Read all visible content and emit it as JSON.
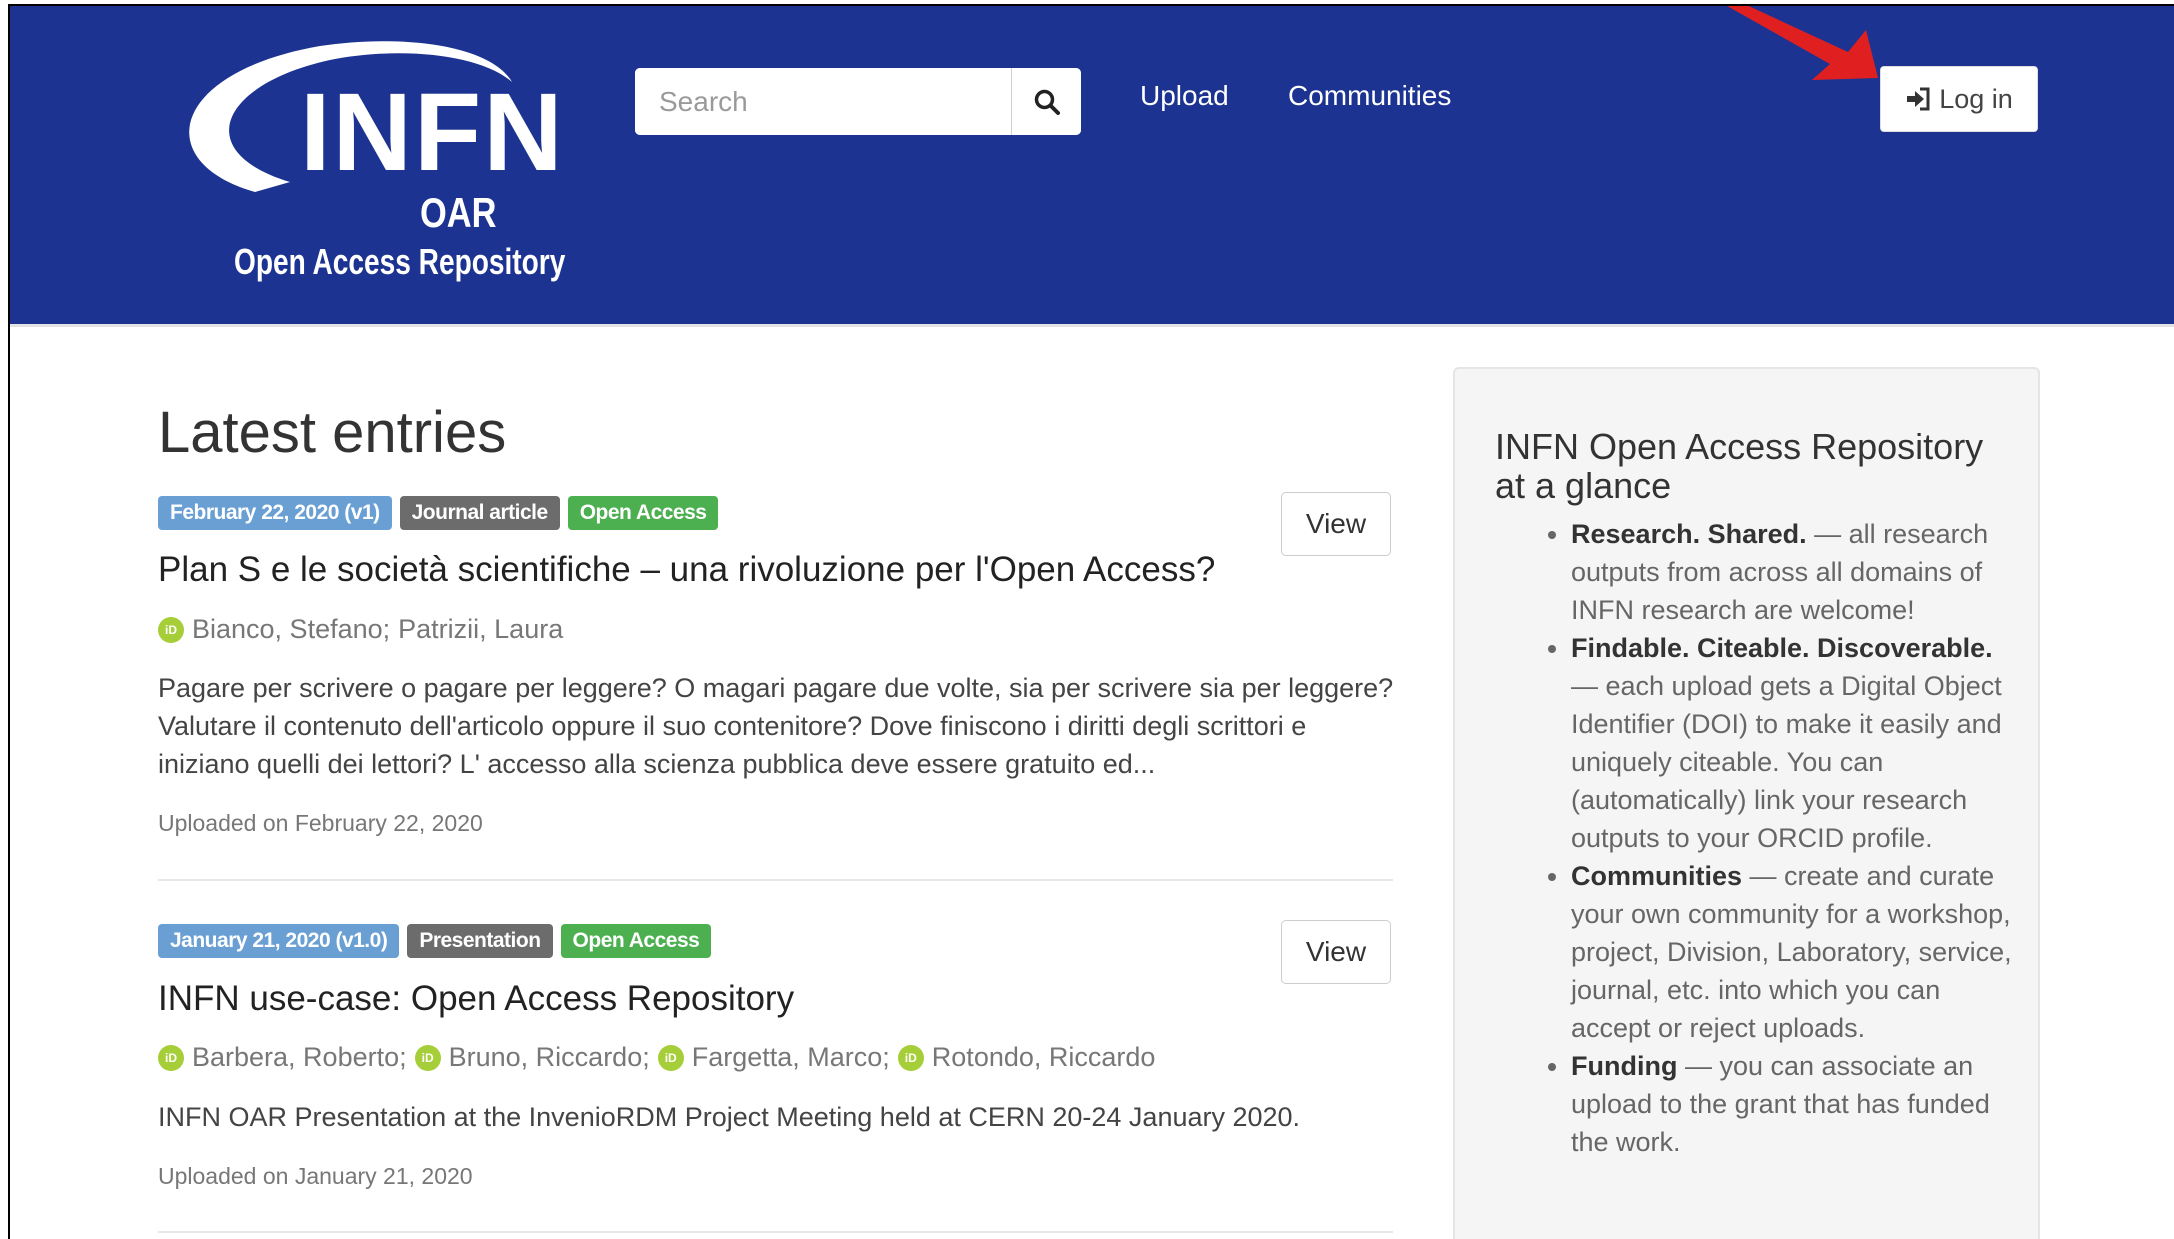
{
  "header": {
    "logo": {
      "main": "INFN",
      "sub1": "OAR",
      "sub2": "Open Access Repository"
    },
    "search": {
      "placeholder": "Search",
      "icon": "search-icon"
    },
    "nav": [
      {
        "label": "Upload"
      },
      {
        "label": "Communities"
      }
    ],
    "login": {
      "label": "Log in",
      "icon": "sign-in-icon"
    },
    "brand_color": "#1c3391"
  },
  "main": {
    "heading": "Latest entries",
    "view_label": "View",
    "records": [
      {
        "date_badge": "February 22, 2020 (v1)",
        "type_badge": "Journal article",
        "access_badge": "Open Access",
        "title": "Plan S e le società scientifiche – una rivoluzione per l'Open Access?",
        "authors": [
          "Bianco, Stefano;",
          "Patrizii, Laura"
        ],
        "description": "Pagare per scrivere o pagare per leggere? O magari pagare due volte, sia per scrivere sia per leggere? Valutare il contenuto dell'articolo oppure il suo contenitore? Dove finiscono i diritti degli scrittori e iniziano quelli dei lettori? L' accesso alla scienza pubblica deve essere gratuito ed...",
        "uploaded": "Uploaded on February 22, 2020"
      },
      {
        "date_badge": "January 21, 2020 (v1.0)",
        "type_badge": "Presentation",
        "access_badge": "Open Access",
        "title": "INFN use-case: Open Access Repository",
        "authors": [
          "Barbera, Roberto;",
          "Bruno, Riccardo;",
          "Fargetta, Marco;",
          "Rotondo, Riccardo"
        ],
        "description": "INFN OAR Presentation at the InvenioRDM Project Meeting held at CERN 20-24 January 2020.",
        "uploaded": "Uploaded on January 21, 2020"
      }
    ]
  },
  "sidebar": {
    "title": "INFN Open Access Repository at a glance",
    "items": [
      {
        "bold": "Research. Shared.",
        "text": " — all research outputs from across all domains of INFN research are welcome!"
      },
      {
        "bold": "Findable. Citeable. Discoverable.",
        "text": " — each upload gets a Digital Object Identifier (DOI) to make it easily and uniquely citeable. You can (automatically) link your research outputs to your ORCID profile."
      },
      {
        "bold": "Communities",
        "text": " — create and curate your own community for a workshop, project, Division, Laboratory, service, journal, etc. into which you can accept or reject uploads."
      },
      {
        "bold": "Funding",
        "text": " — you can associate an upload to the grant that has funded the work."
      }
    ]
  },
  "colors": {
    "date_badge": "#6a9fd4",
    "type_badge": "#6c6c6c",
    "access_badge": "#4caf50",
    "orcid": "#a6ce39",
    "arrow": "#e02020"
  }
}
